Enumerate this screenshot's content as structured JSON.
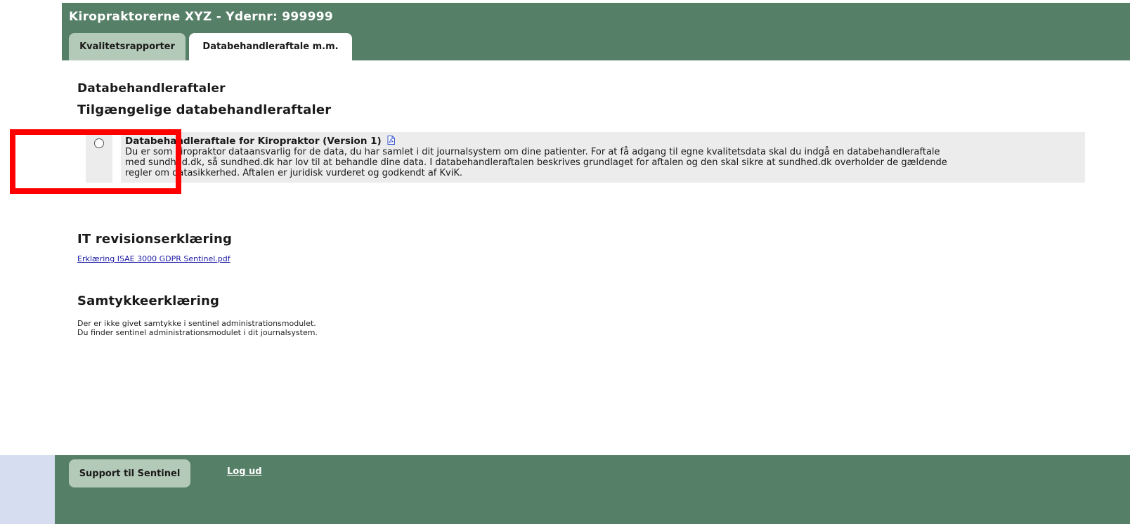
{
  "header": {
    "title": "Kiropraktorerne XYZ - Ydernr: 999999",
    "tabs": [
      {
        "label": "Kvalitetsrapporter",
        "active": false
      },
      {
        "label": "Databehandleraftale m.m.",
        "active": true
      }
    ]
  },
  "agreements": {
    "heading": "Databehandleraftaler",
    "subheading": "Tilgængelige databehandleraftaler",
    "items": [
      {
        "title": "Databehandleraftale for Kiropraktor (Version 1)",
        "icon": "pdf-icon",
        "description_lines": [
          "Du er som kiropraktor dataansvarlig for de data, du har samlet i dit journalsystem om dine patienter. For at få adgang til egne kvalitetsdata skal du indgå en databehandleraftale",
          "med sundhed.dk, så sundhed.dk har lov til at behandle dine data. I databehandleraftalen beskrives grundlaget for aftalen og den skal sikre at sundhed.dk overholder de gældende",
          "regler om datasikkerhed. Aftalen er juridisk vurderet og godkendt af KviK."
        ],
        "selected": false
      }
    ]
  },
  "it_revision": {
    "heading": "IT revisionserklæring",
    "link": "Erklæring ISAE 3000 GDPR Sentinel.pdf"
  },
  "consent": {
    "heading": "Samtykkeerklæring",
    "lines": [
      "Der er ikke givet samtykke i sentinel administrationsmodulet.",
      "Du finder sentinel administrationsmodulet i dit journalsystem."
    ]
  },
  "footer": {
    "support_label": "Support til Sentinel",
    "logout_label": "Log ud"
  },
  "colors": {
    "header_green": "#557f66",
    "inactive_tab": "#b4cab8",
    "highlight_red": "#ff0000"
  }
}
